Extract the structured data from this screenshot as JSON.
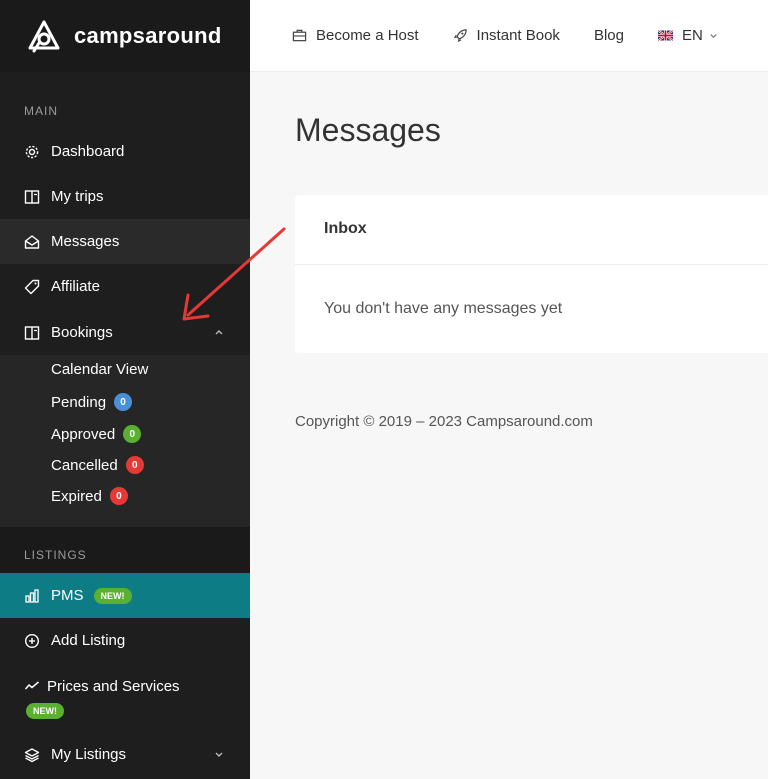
{
  "brand": {
    "name": "campsaround"
  },
  "topbar": {
    "become_host": "Become a Host",
    "instant_book": "Instant Book",
    "blog": "Blog",
    "language": "EN"
  },
  "sidebar": {
    "main_label": "MAIN",
    "dashboard": "Dashboard",
    "my_trips": "My trips",
    "messages": "Messages",
    "affiliate": "Affiliate",
    "bookings": "Bookings",
    "bookings_sub": [
      {
        "label": "Calendar View"
      },
      {
        "label": "Pending",
        "count": "0",
        "color": "#4a90d9"
      },
      {
        "label": "Approved",
        "count": "0",
        "color": "#5ab031"
      },
      {
        "label": "Cancelled",
        "count": "0",
        "color": "#e53935"
      },
      {
        "label": "Expired",
        "count": "0",
        "color": "#e53935"
      }
    ],
    "listings_label": "LISTINGS",
    "pms": "PMS",
    "new_badge": "NEW!",
    "add_listing": "Add Listing",
    "prices_services": "Prices and Services",
    "my_listings": "My Listings"
  },
  "main": {
    "title": "Messages",
    "inbox_title": "Inbox",
    "empty_text": "You don't have any messages yet",
    "copyright": "Copyright © 2019 – 2023 Campsaround.com"
  },
  "colors": {
    "sidebar_bg": "#1e1e1e",
    "accent_teal": "#0d7c85",
    "new_green": "#5ab031",
    "annotation_red": "#e53935"
  }
}
